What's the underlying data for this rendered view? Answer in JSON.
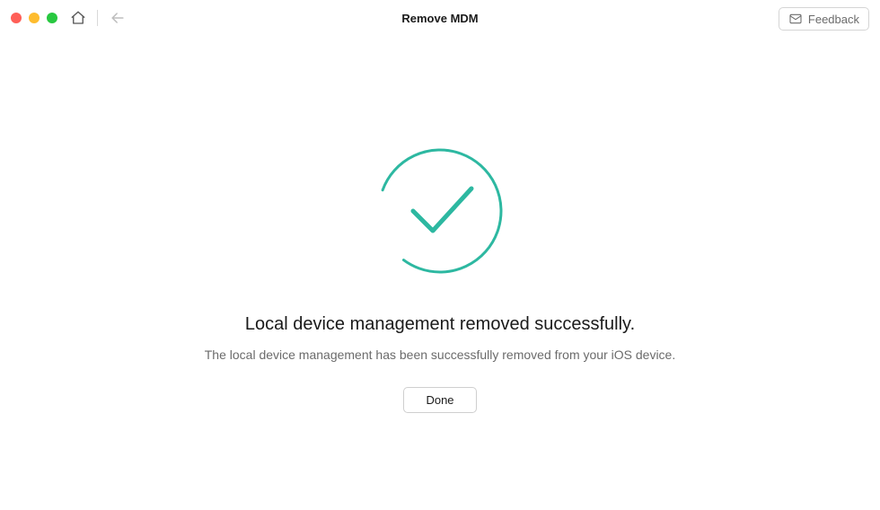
{
  "window": {
    "title": "Remove MDM"
  },
  "header": {
    "feedback_label": "Feedback"
  },
  "content": {
    "headline": "Local device management removed successfully.",
    "subtext": "The local device management has been successfully removed from your iOS device.",
    "done_label": "Done"
  },
  "colors": {
    "accent": "#2db8a1"
  }
}
